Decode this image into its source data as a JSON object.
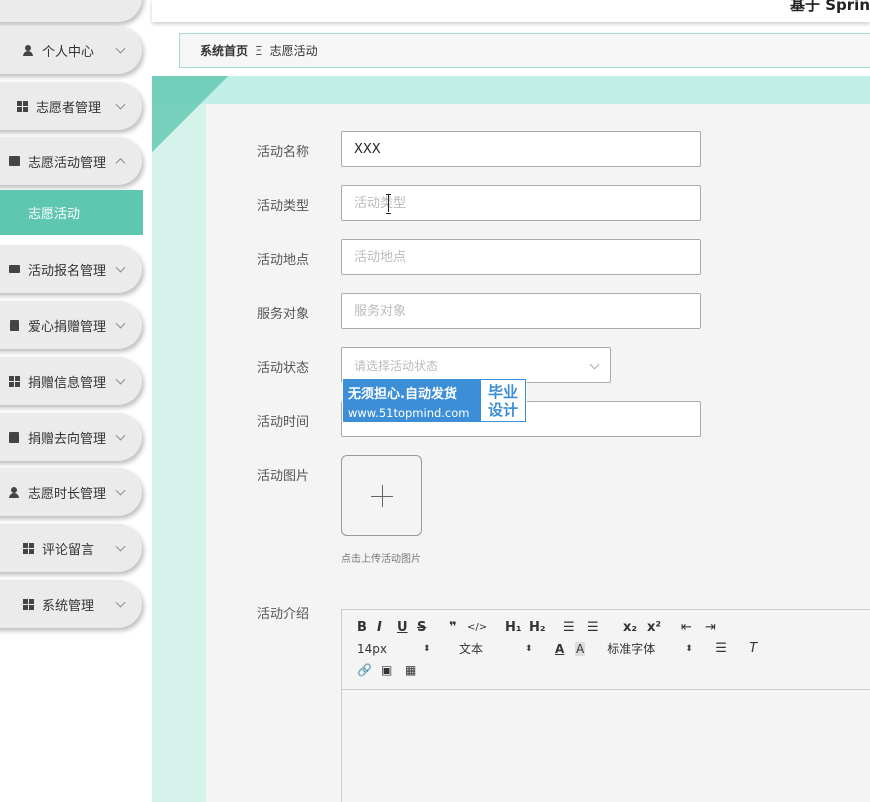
{
  "header": {
    "brand_partial": "基于 Sprin"
  },
  "breadcrumb": {
    "home": "系统首页",
    "separator": "Ξ",
    "current": "志愿活动"
  },
  "sidebar": {
    "items": [
      {
        "label": "个人中心",
        "icon": "user-icon"
      },
      {
        "label": "志愿者管理",
        "icon": "grid-icon"
      },
      {
        "label": "志愿活动管理",
        "icon": "megaphone-icon",
        "expanded": true
      },
      {
        "label": "活动报名管理",
        "icon": "briefcase-icon"
      },
      {
        "label": "爱心捐赠管理",
        "icon": "clipboard-icon"
      },
      {
        "label": "捐赠信息管理",
        "icon": "grid-icon"
      },
      {
        "label": "捐赠去向管理",
        "icon": "signpost-icon"
      },
      {
        "label": "志愿时长管理",
        "icon": "user-icon"
      },
      {
        "label": "评论留言",
        "icon": "grid-icon"
      },
      {
        "label": "系统管理",
        "icon": "grid-icon"
      }
    ],
    "active_sub": "志愿活动",
    "accent": "#5fc7b0"
  },
  "form": {
    "name": {
      "label": "活动名称",
      "value": "XXX",
      "placeholder": ""
    },
    "type": {
      "label": "活动类型",
      "value": "",
      "placeholder": "活动类型"
    },
    "location": {
      "label": "活动地点",
      "value": "",
      "placeholder": "活动地点"
    },
    "target": {
      "label": "服务对象",
      "value": "",
      "placeholder": "服务对象"
    },
    "status": {
      "label": "活动状态",
      "placeholder": "请选择活动状态"
    },
    "time": {
      "label": "活动时间",
      "value": "",
      "placeholder": ""
    },
    "image": {
      "label": "活动图片",
      "tip": "点击上传活动图片"
    },
    "intro": {
      "label": "活动介绍"
    }
  },
  "editor": {
    "font_size": "14px",
    "paragraph": "文本",
    "font_family": "标准字体",
    "row1": [
      "B",
      "I",
      "U",
      "S",
      "❞",
      "</>",
      "H₁",
      "H₂",
      "☰",
      "☰",
      "x₂",
      "x²",
      "⇤",
      "⇥"
    ],
    "row3": [
      "🔗",
      "▣",
      "▦"
    ]
  },
  "watermark": {
    "line1": "无须担心.自动发货",
    "line2": "www.51topmind.com",
    "right1": "毕业",
    "right2": "设计"
  }
}
